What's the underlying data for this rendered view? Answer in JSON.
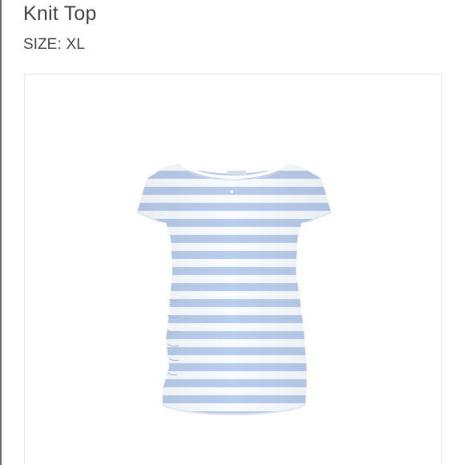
{
  "product": {
    "title": "Knit Top",
    "size_label": "SIZE:",
    "size_value": "XL"
  },
  "image": {
    "alt": "Light blue and white striped short sleeve knit maternity top",
    "stripe_blue": "#b9cdec",
    "stripe_white": "#ffffff"
  }
}
